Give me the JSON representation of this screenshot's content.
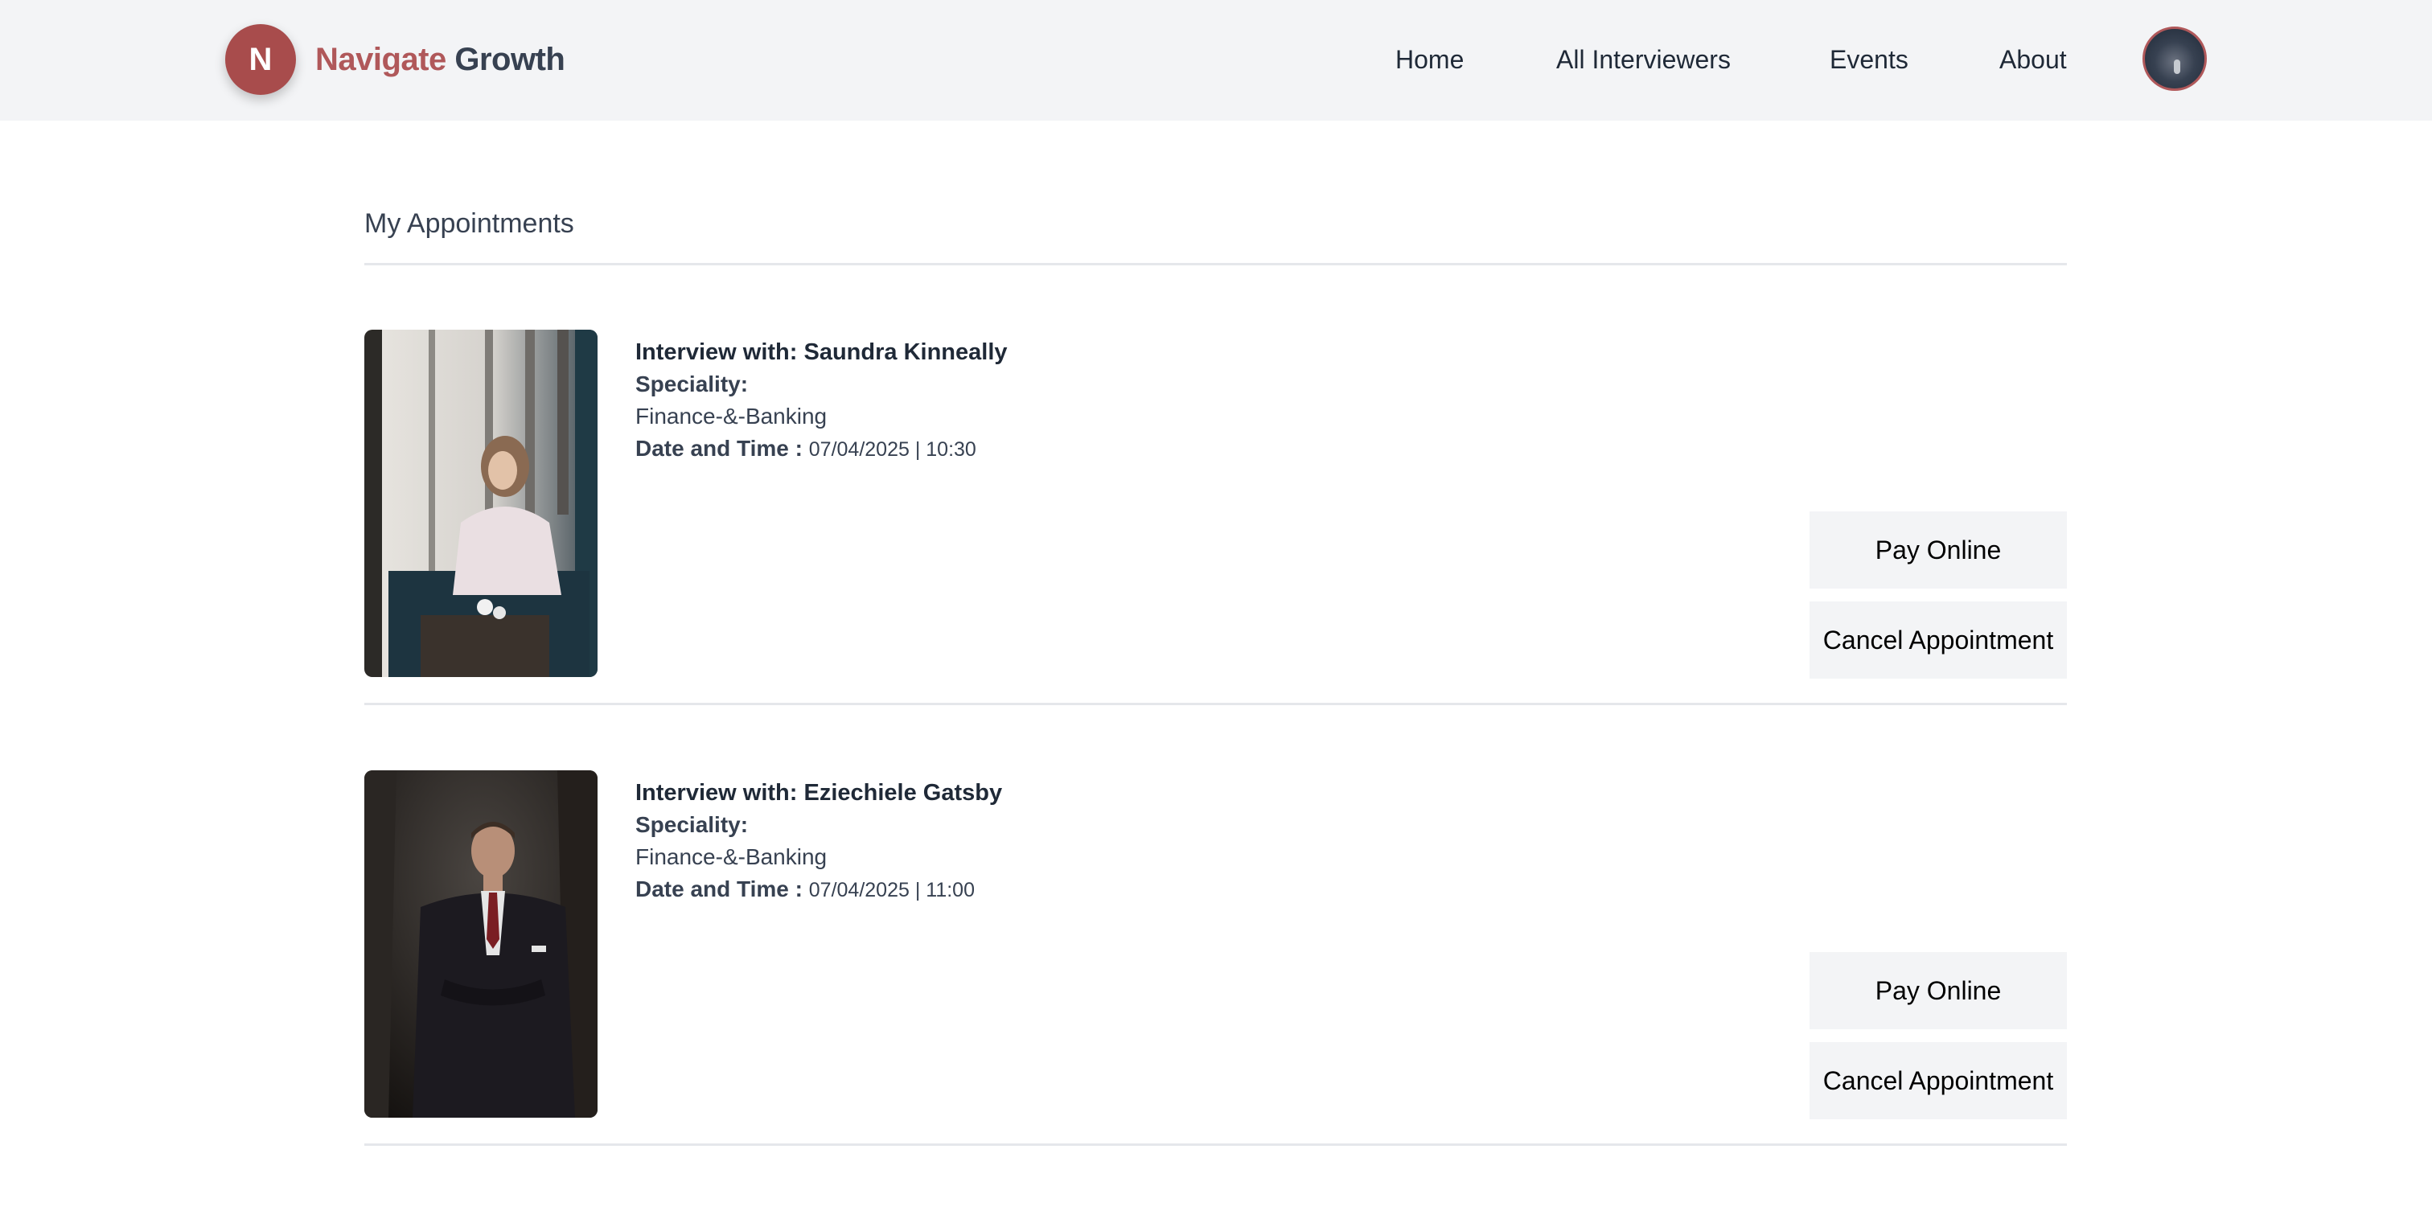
{
  "brand": {
    "badge_letter": "N",
    "name_part1": "Navigate",
    "name_part2": "Growth",
    "accent_color": "#a84c4c"
  },
  "nav": {
    "home": "Home",
    "all_interviewers": "All Interviewers",
    "events": "Events",
    "about": "About"
  },
  "page": {
    "title": "My Appointments"
  },
  "appointments": [
    {
      "interview_label": "Interview with:",
      "interviewer": "Saundra Kinneally",
      "speciality_label": "Speciality:",
      "speciality": "Finance-&-Banking",
      "datetime_label": "Date and Time :",
      "datetime": "07/04/2025 | 10:30",
      "pay_label": "Pay Online",
      "cancel_label": "Cancel Appointment"
    },
    {
      "interview_label": "Interview with:",
      "interviewer": "Eziechiele Gatsby",
      "speciality_label": "Speciality:",
      "speciality": "Finance-&-Banking",
      "datetime_label": "Date and Time :",
      "datetime": "07/04/2025 | 11:00",
      "pay_label": "Pay Online",
      "cancel_label": "Cancel Appointment"
    }
  ]
}
